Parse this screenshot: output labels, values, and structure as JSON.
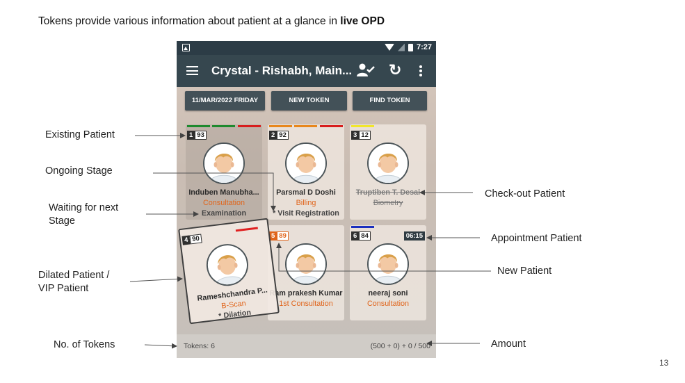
{
  "slide": {
    "title_prefix": "Tokens provide various information about patient at a glance in ",
    "title_bold": "live OPD",
    "page_number": "13"
  },
  "statusbar": {
    "time": "7:27"
  },
  "appbar": {
    "title": "Crystal - Rishabh, Main..."
  },
  "buttons": {
    "date": "11/MAR/2022 FRIDAY",
    "new_token": "NEW TOKEN",
    "find_token": "FIND TOKEN"
  },
  "cards": [
    {
      "number": "1",
      "value": "93",
      "name": "Induben Manubha...",
      "stage": "Consultation",
      "next": "Examination",
      "stripes": [
        "#1e8a2e",
        "#1e8a2e",
        "#d81e1e"
      ]
    },
    {
      "number": "2",
      "value": "92",
      "name": "Parsmal  D  Doshi",
      "stage": "Billing",
      "next": "* Visit Registration",
      "stripes": [
        "#e8871c",
        "#e8871c",
        "#d81e1e"
      ]
    },
    {
      "number": "3",
      "value": "12",
      "name": "Truptiben T. Desai",
      "stage": "Biometry",
      "next": "",
      "stripes": [
        "#f1e62a"
      ]
    },
    {
      "number": "4",
      "value": "90",
      "name": "Rameshchandra P...",
      "stage": "B-Scan",
      "next": "* Dilation"
    },
    {
      "number": "5",
      "value": "89",
      "name": "Ram prakesh Kumar",
      "stage": "1st Consultation",
      "next": ""
    },
    {
      "number": "6",
      "value": "84",
      "name": "neeraj soni",
      "stage": "Consultation",
      "next": "",
      "appointment_time": "06:15",
      "stripes": [
        "#1a2fbf"
      ]
    }
  ],
  "footer": {
    "tokens": "Tokens: 6",
    "amount": "(500 + 0) + 0 / 500"
  },
  "annotations": {
    "existing": "Existing Patient",
    "ongoing": "Ongoing Stage",
    "waiting_line1": "Waiting for next",
    "waiting_line2": "Stage",
    "dilated_line1": "Dilated Patient /",
    "dilated_line2": "VIP Patient",
    "no_tokens": "No. of Tokens",
    "checkout": "Check-out Patient",
    "appointment": "Appointment Patient",
    "new_patient": "New Patient",
    "amount": "Amount"
  },
  "icons": [
    "image-icon",
    "wifi-icon",
    "signal-icon",
    "battery-icon",
    "menu-icon",
    "person-check-icon",
    "sync-icon",
    "more-vert-icon",
    "avatar-icon"
  ]
}
